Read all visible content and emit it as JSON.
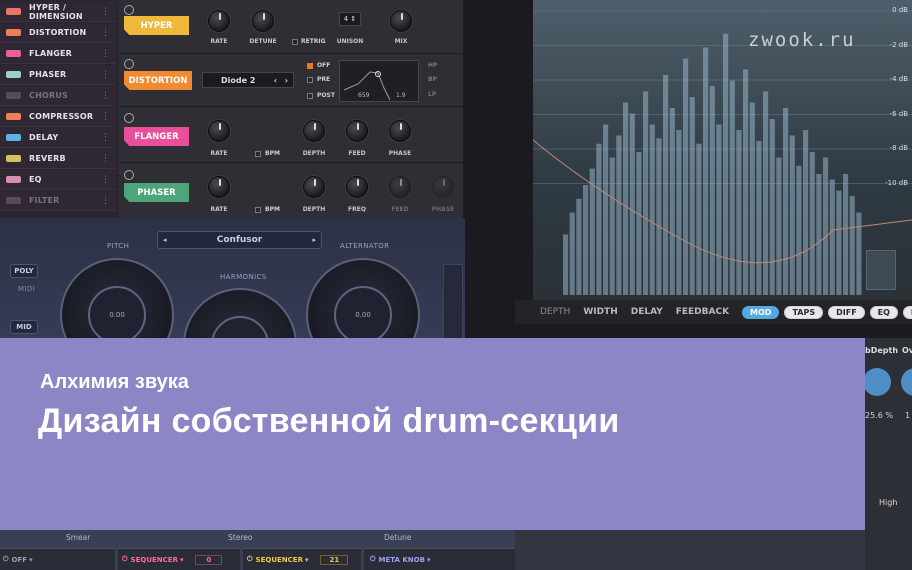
{
  "fx_list": [
    {
      "label": "HYPER / DIMENSION",
      "color": "#e8756a",
      "enabled": true
    },
    {
      "label": "DISTORTION",
      "color": "#ef7f5a",
      "enabled": true
    },
    {
      "label": "FLANGER",
      "color": "#ea5f9a",
      "enabled": true
    },
    {
      "label": "PHASER",
      "color": "#9ad3c6",
      "enabled": true
    },
    {
      "label": "CHORUS",
      "color": "#5a4a5e",
      "enabled": false
    },
    {
      "label": "COMPRESSOR",
      "color": "#ef7f5a",
      "enabled": true
    },
    {
      "label": "DELAY",
      "color": "#5ab4e6",
      "enabled": true
    },
    {
      "label": "REVERB",
      "color": "#d4c25a",
      "enabled": true
    },
    {
      "label": "EQ",
      "color": "#d88fb0",
      "enabled": true
    },
    {
      "label": "FILTER",
      "color": "#5a4a5e",
      "enabled": false
    }
  ],
  "hyper": {
    "tag": "HYPER",
    "color": "#f0b83a",
    "rate": "RATE",
    "detune": "DETUNE",
    "retrig": "RETRIG",
    "unison": "UNISON",
    "unison_value": "4",
    "mix": "MIX"
  },
  "distortion": {
    "tag": "DISTORTION",
    "color": "#f08a33",
    "mode": "Diode 2",
    "off": "OFF",
    "pre": "PRE",
    "post": "POST",
    "freq_value": "659",
    "q_value": "1.9",
    "hp": "HP",
    "bp": "BP",
    "lp": "LP"
  },
  "flanger": {
    "tag": "FLANGER",
    "color": "#ea4f9b",
    "rate": "RATE",
    "bpm": "BPM",
    "depth": "DEPTH",
    "feed": "FEED",
    "phase": "PHASE"
  },
  "phaser": {
    "tag": "PHASER",
    "color": "#4fa57a",
    "rate": "RATE",
    "bpm": "BPM",
    "depth": "DEPTH",
    "freq": "FREQ",
    "feed": "FEED",
    "phase": "PHASE"
  },
  "synth": {
    "preset": "Confusor",
    "pitch": "PITCH",
    "harmonics": "HARMONICS",
    "alternator": "ALTERNATOR",
    "poly": "POLY",
    "midi": "MIDI",
    "mid": "MID",
    "pitch_value": "0.00",
    "alternator_value": "0.00"
  },
  "spectrum": {
    "watermark": "zwook.ru",
    "db_labels": [
      "0 dB",
      "-2 dB",
      "-4 dB",
      "-6 dB",
      "-8 dB",
      "-10 dB"
    ],
    "bars": [
      0.22,
      0.3,
      0.35,
      0.4,
      0.46,
      0.55,
      0.62,
      0.5,
      0.58,
      0.7,
      0.66,
      0.52,
      0.74,
      0.62,
      0.57,
      0.8,
      0.68,
      0.6,
      0.86,
      0.72,
      0.55,
      0.9,
      0.76,
      0.62,
      0.95,
      0.78,
      0.6,
      0.82,
      0.7,
      0.56,
      0.74,
      0.64,
      0.5,
      0.68,
      0.58,
      0.47,
      0.6,
      0.52,
      0.44,
      0.5,
      0.42,
      0.38,
      0.44,
      0.36,
      0.3
    ]
  },
  "tabs": {
    "plain": [
      "DEPTH",
      "WIDTH",
      "DELAY",
      "FEEDBACK"
    ],
    "pills": [
      "MOD",
      "TAPS",
      "DIFF",
      "EQ",
      "DRIVE"
    ],
    "active": "MOD"
  },
  "right_panel": {
    "label1": "bDepth",
    "label2": "Ov",
    "value": "25.6 %",
    "value2": "1"
  },
  "bottom": {
    "smear": "Smear",
    "stereo": "Stereo",
    "detune": "Detune",
    "off": "OFF",
    "seq1": "SEQUENCER",
    "seq1_val": "0",
    "seq2": "SEQUENCER",
    "seq2_val": "21",
    "meta": "META KNOB",
    "high": "High"
  },
  "banner": {
    "subtitle": "Алхимия звука",
    "title": "Дизайн собственной drum-секции"
  }
}
